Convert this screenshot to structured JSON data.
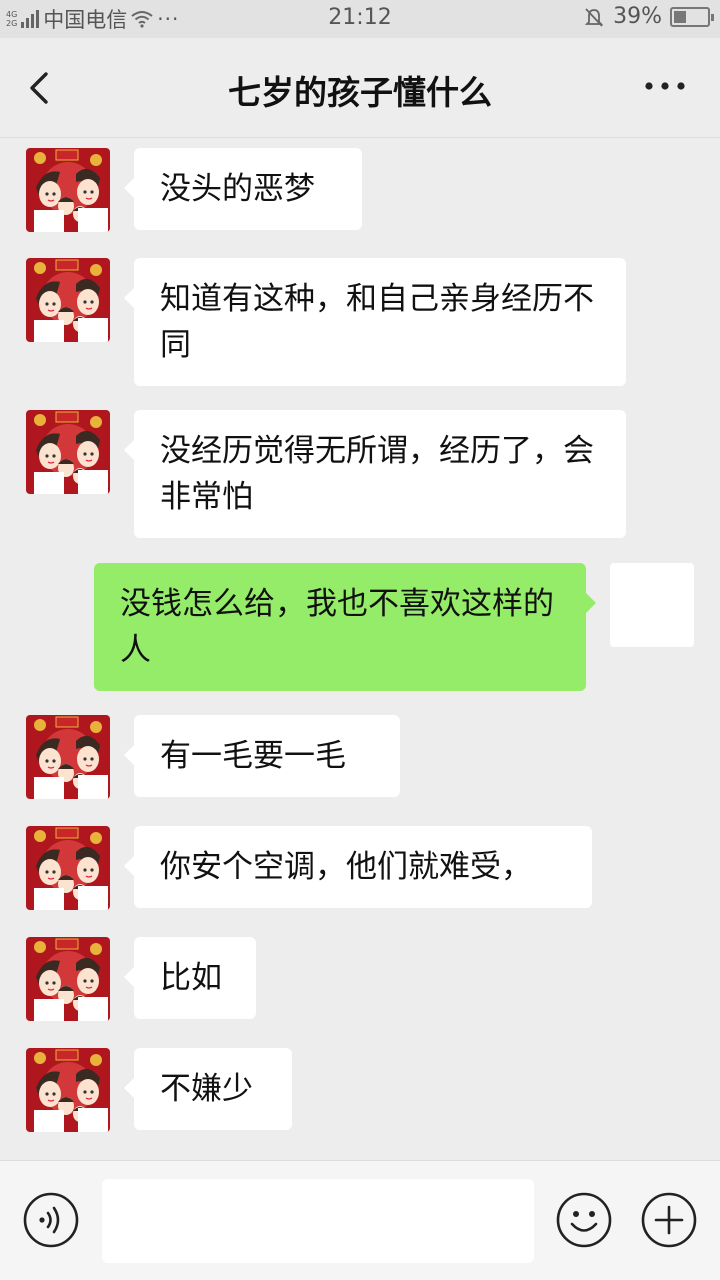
{
  "status_bar": {
    "network_type_top": "4G",
    "network_type_bottom": "2G",
    "carrier": "中国电信",
    "more_indicator": "···",
    "time": "21:12",
    "battery": "39%",
    "battery_level": 0.39,
    "icons": [
      "signal-icon",
      "wifi-icon",
      "mute-icon",
      "battery-icon"
    ]
  },
  "header": {
    "title": "七岁的孩子懂什么",
    "back_icon": "chevron-left-icon",
    "more_icon": "more-dots-icon"
  },
  "messages": [
    {
      "side": "left",
      "text": "没头的恶梦"
    },
    {
      "side": "left",
      "text": "知道有这种，和自己亲身经历不同"
    },
    {
      "side": "left",
      "text": "没经历觉得无所谓，经历了，会非常怕"
    },
    {
      "side": "right",
      "text": "没钱怎么给，我也不喜欢这样的人"
    },
    {
      "side": "left",
      "text": "有一毛要一毛"
    },
    {
      "side": "left",
      "text": "你安个空调，他们就难受，"
    },
    {
      "side": "left",
      "text": "比如"
    },
    {
      "side": "left",
      "text": "不嫌少"
    }
  ],
  "input_bar": {
    "voice_icon": "voice-icon",
    "emoji_icon": "emoji-icon",
    "plus_icon": "plus-icon",
    "text_value": ""
  },
  "colors": {
    "background": "#ededed",
    "sent_bubble": "#95ec69",
    "received_bubble": "#ffffff"
  }
}
